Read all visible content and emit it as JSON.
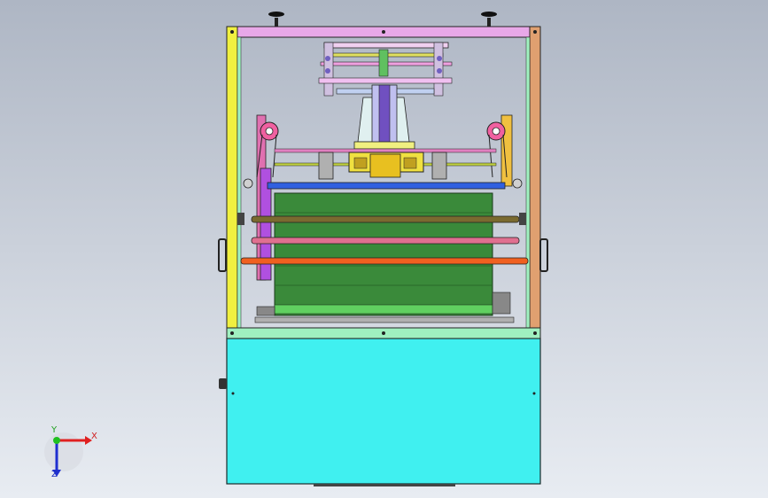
{
  "viewport": {
    "background_top": "#aeb6c4",
    "background_bottom": "#e8ecf2"
  },
  "triad": {
    "x_label": "X",
    "y_label": "Y",
    "z_label": "Z",
    "x_color": "#e02020",
    "y_color": "#20c020",
    "z_color": "#2030d0"
  },
  "colors": {
    "frame_top": "#e8a8e8",
    "frame_left": "#f0f040",
    "frame_right": "#e0a070",
    "frame_side": "#a0f0c0",
    "cabinet": "#40f0f0",
    "belt": "#3a8a3a",
    "roller_brown": "#7a6a30",
    "roller_pink": "#e07090",
    "roller_orange": "#f06020",
    "bar_blue": "#3060e0",
    "gear_yellow": "#f0e040",
    "motor_purple": "#c060e0",
    "pulley_pink": "#f060a0"
  },
  "icons": {
    "adjust_knob": "leveling-knob-icon",
    "triad": "axis-triad-icon"
  }
}
